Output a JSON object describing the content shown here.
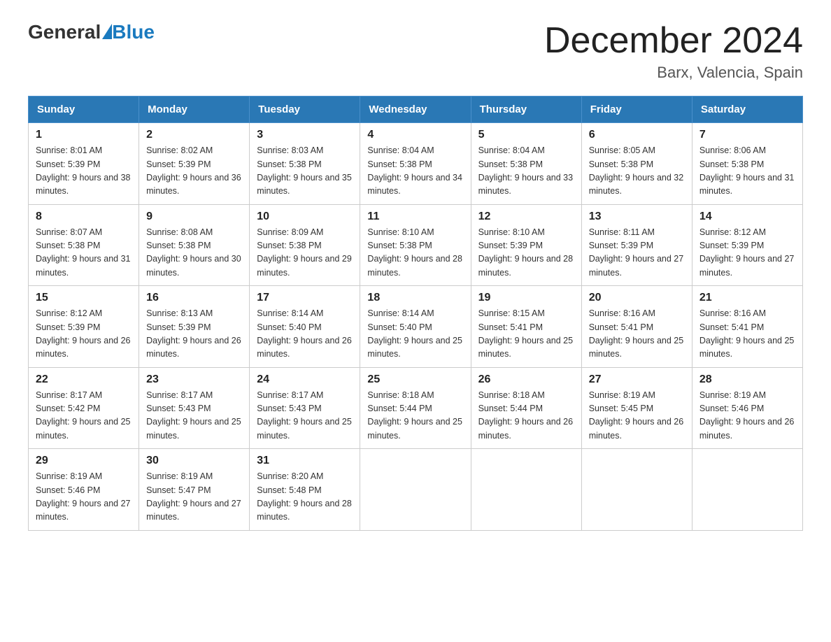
{
  "logo": {
    "general": "General",
    "blue": "Blue",
    "subtitle": ""
  },
  "title": "December 2024",
  "location": "Barx, Valencia, Spain",
  "days_of_week": [
    "Sunday",
    "Monday",
    "Tuesday",
    "Wednesday",
    "Thursday",
    "Friday",
    "Saturday"
  ],
  "weeks": [
    [
      {
        "day": "1",
        "sunrise": "8:01 AM",
        "sunset": "5:39 PM",
        "daylight": "9 hours and 38 minutes."
      },
      {
        "day": "2",
        "sunrise": "8:02 AM",
        "sunset": "5:39 PM",
        "daylight": "9 hours and 36 minutes."
      },
      {
        "day": "3",
        "sunrise": "8:03 AM",
        "sunset": "5:38 PM",
        "daylight": "9 hours and 35 minutes."
      },
      {
        "day": "4",
        "sunrise": "8:04 AM",
        "sunset": "5:38 PM",
        "daylight": "9 hours and 34 minutes."
      },
      {
        "day": "5",
        "sunrise": "8:04 AM",
        "sunset": "5:38 PM",
        "daylight": "9 hours and 33 minutes."
      },
      {
        "day": "6",
        "sunrise": "8:05 AM",
        "sunset": "5:38 PM",
        "daylight": "9 hours and 32 minutes."
      },
      {
        "day": "7",
        "sunrise": "8:06 AM",
        "sunset": "5:38 PM",
        "daylight": "9 hours and 31 minutes."
      }
    ],
    [
      {
        "day": "8",
        "sunrise": "8:07 AM",
        "sunset": "5:38 PM",
        "daylight": "9 hours and 31 minutes."
      },
      {
        "day": "9",
        "sunrise": "8:08 AM",
        "sunset": "5:38 PM",
        "daylight": "9 hours and 30 minutes."
      },
      {
        "day": "10",
        "sunrise": "8:09 AM",
        "sunset": "5:38 PM",
        "daylight": "9 hours and 29 minutes."
      },
      {
        "day": "11",
        "sunrise": "8:10 AM",
        "sunset": "5:38 PM",
        "daylight": "9 hours and 28 minutes."
      },
      {
        "day": "12",
        "sunrise": "8:10 AM",
        "sunset": "5:39 PM",
        "daylight": "9 hours and 28 minutes."
      },
      {
        "day": "13",
        "sunrise": "8:11 AM",
        "sunset": "5:39 PM",
        "daylight": "9 hours and 27 minutes."
      },
      {
        "day": "14",
        "sunrise": "8:12 AM",
        "sunset": "5:39 PM",
        "daylight": "9 hours and 27 minutes."
      }
    ],
    [
      {
        "day": "15",
        "sunrise": "8:12 AM",
        "sunset": "5:39 PM",
        "daylight": "9 hours and 26 minutes."
      },
      {
        "day": "16",
        "sunrise": "8:13 AM",
        "sunset": "5:39 PM",
        "daylight": "9 hours and 26 minutes."
      },
      {
        "day": "17",
        "sunrise": "8:14 AM",
        "sunset": "5:40 PM",
        "daylight": "9 hours and 26 minutes."
      },
      {
        "day": "18",
        "sunrise": "8:14 AM",
        "sunset": "5:40 PM",
        "daylight": "9 hours and 25 minutes."
      },
      {
        "day": "19",
        "sunrise": "8:15 AM",
        "sunset": "5:41 PM",
        "daylight": "9 hours and 25 minutes."
      },
      {
        "day": "20",
        "sunrise": "8:16 AM",
        "sunset": "5:41 PM",
        "daylight": "9 hours and 25 minutes."
      },
      {
        "day": "21",
        "sunrise": "8:16 AM",
        "sunset": "5:41 PM",
        "daylight": "9 hours and 25 minutes."
      }
    ],
    [
      {
        "day": "22",
        "sunrise": "8:17 AM",
        "sunset": "5:42 PM",
        "daylight": "9 hours and 25 minutes."
      },
      {
        "day": "23",
        "sunrise": "8:17 AM",
        "sunset": "5:43 PM",
        "daylight": "9 hours and 25 minutes."
      },
      {
        "day": "24",
        "sunrise": "8:17 AM",
        "sunset": "5:43 PM",
        "daylight": "9 hours and 25 minutes."
      },
      {
        "day": "25",
        "sunrise": "8:18 AM",
        "sunset": "5:44 PM",
        "daylight": "9 hours and 25 minutes."
      },
      {
        "day": "26",
        "sunrise": "8:18 AM",
        "sunset": "5:44 PM",
        "daylight": "9 hours and 26 minutes."
      },
      {
        "day": "27",
        "sunrise": "8:19 AM",
        "sunset": "5:45 PM",
        "daylight": "9 hours and 26 minutes."
      },
      {
        "day": "28",
        "sunrise": "8:19 AM",
        "sunset": "5:46 PM",
        "daylight": "9 hours and 26 minutes."
      }
    ],
    [
      {
        "day": "29",
        "sunrise": "8:19 AM",
        "sunset": "5:46 PM",
        "daylight": "9 hours and 27 minutes."
      },
      {
        "day": "30",
        "sunrise": "8:19 AM",
        "sunset": "5:47 PM",
        "daylight": "9 hours and 27 minutes."
      },
      {
        "day": "31",
        "sunrise": "8:20 AM",
        "sunset": "5:48 PM",
        "daylight": "9 hours and 28 minutes."
      },
      null,
      null,
      null,
      null
    ]
  ]
}
